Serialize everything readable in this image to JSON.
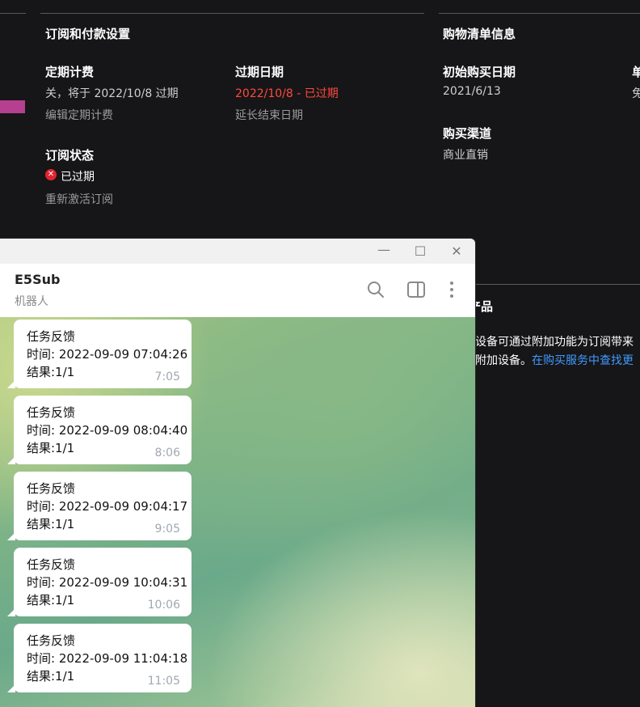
{
  "subscription": {
    "section_title": "订阅和付款设置",
    "recurring": {
      "label": "定期计费",
      "value": "关，将于 2022/10/8 过期",
      "action": "编辑定期计费"
    },
    "expiry": {
      "label": "过期日期",
      "value": "2022/10/8 - 已过期",
      "action": "延长结束日期"
    },
    "status": {
      "label": "订阅状态",
      "value": "已过期",
      "action": "重新激活订阅"
    }
  },
  "billing": {
    "section_title": "购物清单信息",
    "purchase_date": {
      "label": "初始购买日期",
      "value": "2021/6/13"
    },
    "channel": {
      "label": "购买渠道",
      "value": "商业直销"
    },
    "cut_label": "单",
    "cut_value": "免"
  },
  "addons": {
    "title_partial": "产品",
    "line1_partial": "设备可通过附加功能为订阅带来",
    "line2_partial": "附加设备。",
    "line2_link": "在购买服务中查找更"
  },
  "telegram": {
    "window_controls": {
      "minimize": "—",
      "maximize": "☐",
      "close": "✕"
    },
    "chat_name": "E5Sub",
    "chat_subtitle": "机器人",
    "icons": [
      "search-icon",
      "sidebar-toggle-icon",
      "more-vert-icon"
    ],
    "messages": [
      {
        "title": "任务反馈",
        "time_line": "时间: 2022-09-09 07:04:26",
        "result": "结果:1/1",
        "sent": "7:05"
      },
      {
        "title": "任务反馈",
        "time_line": "时间: 2022-09-09 08:04:40",
        "result": "结果:1/1",
        "sent": "8:06"
      },
      {
        "title": "任务反馈",
        "time_line": "时间: 2022-09-09 09:04:17",
        "result": "结果:1/1",
        "sent": "9:05"
      },
      {
        "title": "任务反馈",
        "time_line": "时间: 2022-09-09 10:04:31",
        "result": "结果:1/1",
        "sent": "10:06"
      },
      {
        "title": "任务反馈",
        "time_line": "时间: 2022-09-09 11:04:18",
        "result": "结果:1/1",
        "sent": "11:05"
      }
    ]
  },
  "colors": {
    "background": "#161517",
    "accent_pink": "#b4408f",
    "expired_red": "#ff4a3d",
    "link_blue": "#3f9bff"
  }
}
